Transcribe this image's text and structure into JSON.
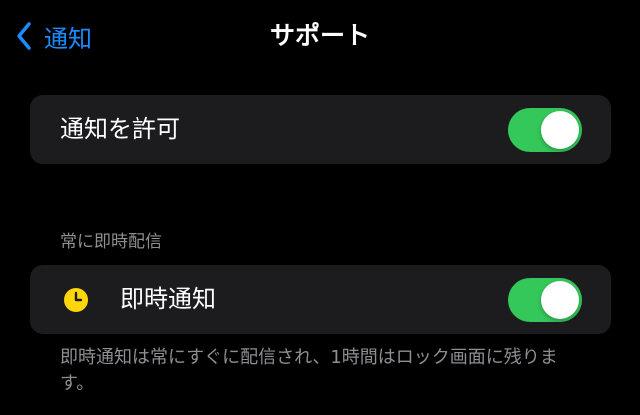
{
  "colors": {
    "background": "#000000",
    "group_background": "#1c1c1e",
    "accent": "#1a8cff",
    "toggle_on": "#34c759",
    "secondary_text": "#8e8e93",
    "clock_icon": "#ffd60a"
  },
  "navbar": {
    "back_icon": "chevron-left-icon",
    "back_label": "通知",
    "title": "サポート"
  },
  "allow_notifications": {
    "label": "通知を許可",
    "enabled": true
  },
  "immediate_delivery": {
    "section_header": "常に即時配信",
    "icon": "clock-icon",
    "label": "即時通知",
    "enabled": true,
    "footer": "即時通知は常にすぐに配信され、1時間はロック画面に残ります。"
  }
}
